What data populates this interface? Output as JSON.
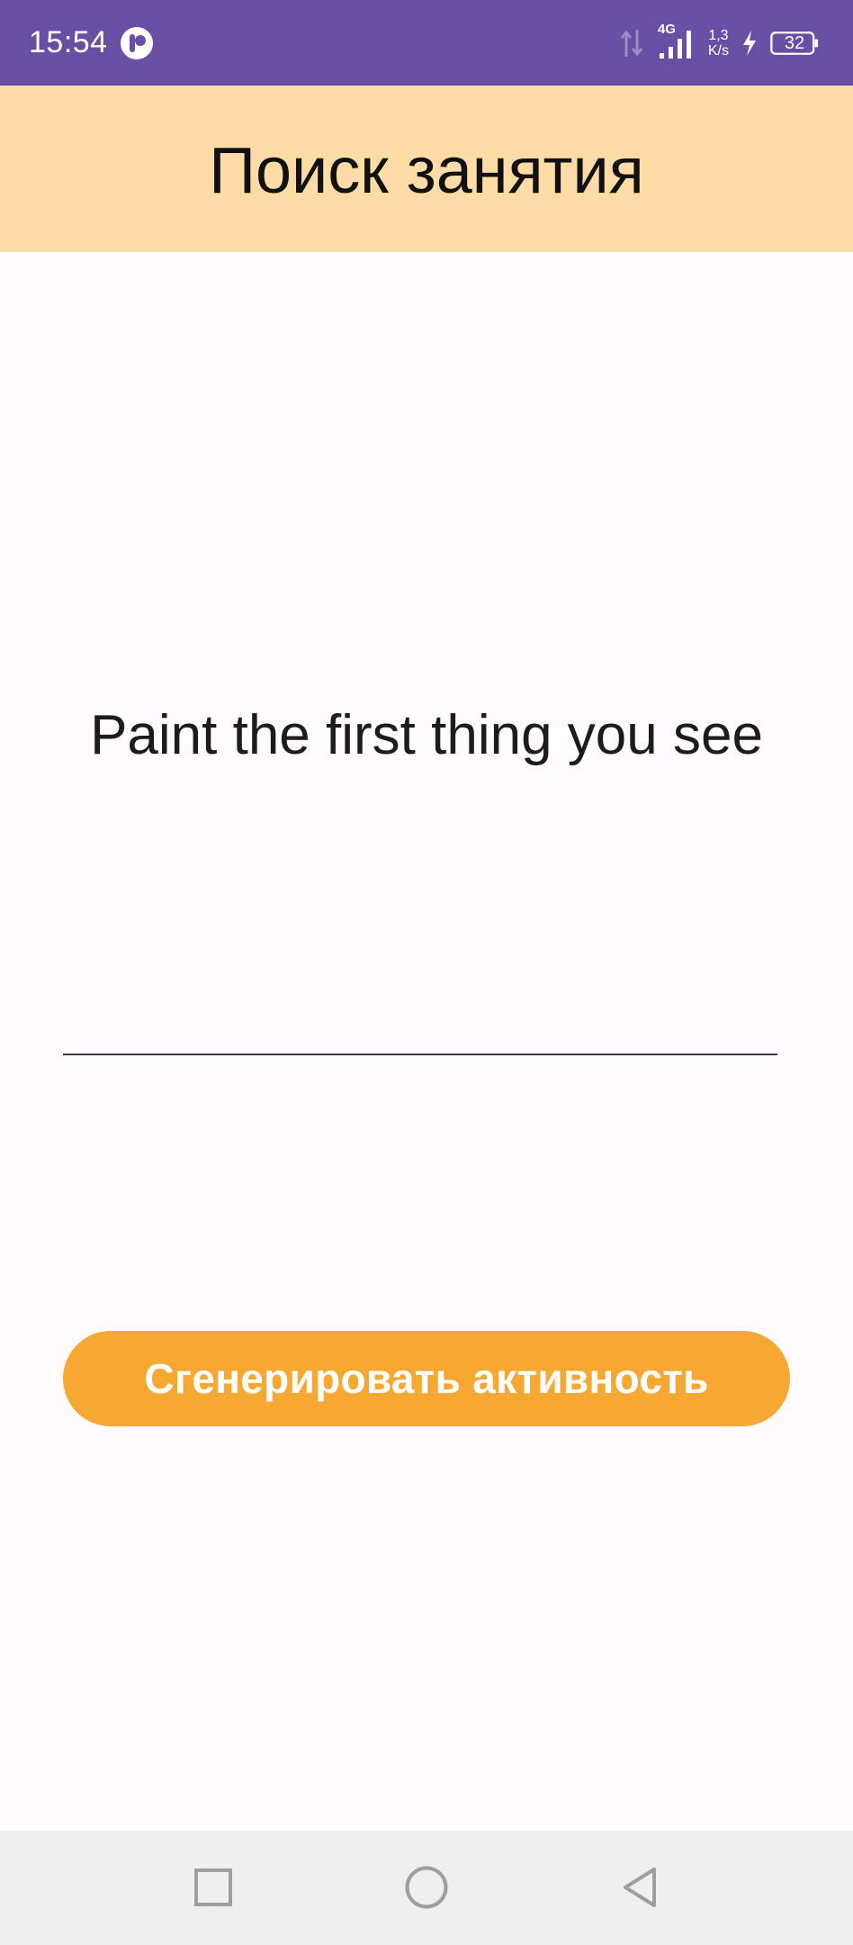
{
  "status_bar": {
    "time": "15:54",
    "network_type": "4G",
    "speed_value": "1,3",
    "speed_unit": "K/s",
    "battery_level": "32",
    "icons": [
      "app-badge-icon",
      "data-arrows-icon",
      "signal-icon",
      "charging-icon",
      "battery-icon"
    ]
  },
  "header": {
    "title": "Поиск занятия"
  },
  "main": {
    "activity_text": "Paint the first thing you see",
    "input_value": "",
    "generate_button_label": "Сгенерировать активность"
  },
  "nav_bar": {
    "icons": [
      "recents-square-icon",
      "home-circle-icon",
      "back-triangle-icon"
    ]
  },
  "colors": {
    "status_bar": "#6750a4",
    "header": "#ffdba6",
    "button": "#f7a832",
    "background": "#fffbfe",
    "nav_bar": "#efefef"
  }
}
